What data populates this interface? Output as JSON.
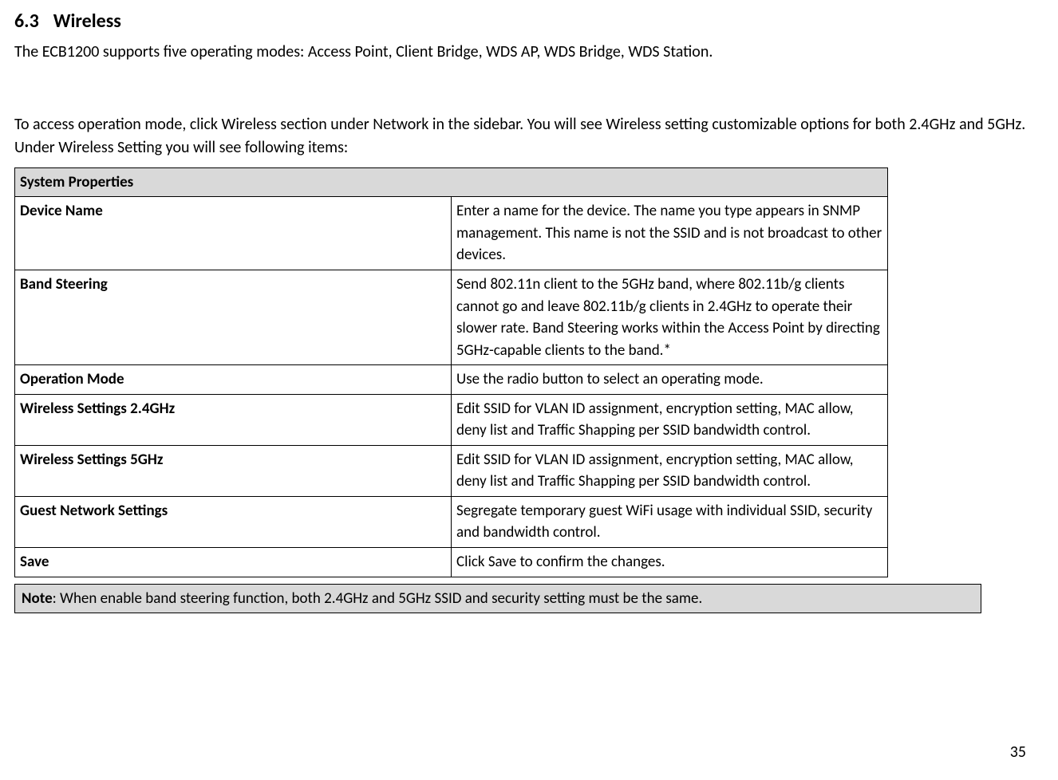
{
  "heading": {
    "number": "6.3",
    "title": "Wireless"
  },
  "intro1": "The ECB1200 supports five operating modes: Access Point, Client Bridge, WDS AP, WDS Bridge, WDS Station.",
  "intro2": "To access operation mode, click Wireless section under Network in the sidebar. You will see Wireless setting customizable options for both 2.4GHz and 5GHz. Under Wireless Setting you will see following items:",
  "table": {
    "header": "System Properties",
    "rows": [
      {
        "label": "Device Name",
        "desc": "Enter a name for the device. The name you type appears in SNMP management. This name is not the SSID and is not broadcast to other devices."
      },
      {
        "label": "Band Steering",
        "desc": "Send 802.11n client to the 5GHz band, where 802.11b/g clients cannot go and leave 802.11b/g clients in 2.4GHz to operate their slower rate. Band Steering works within the Access Point by directing 5GHz-capable clients to the band.*"
      },
      {
        "label": "Operation Mode",
        "desc": "Use the radio button to select an operating mode."
      },
      {
        "label": "Wireless Settings 2.4GHz",
        "desc": "Edit SSID for VLAN ID assignment, encryption setting, MAC allow, deny list and Traffic Shapping per SSID bandwidth control."
      },
      {
        "label": "Wireless Settings 5GHz",
        "desc": "Edit SSID for VLAN ID assignment, encryption setting, MAC allow, deny list and Traffic Shapping per SSID bandwidth control."
      },
      {
        "label": "Guest Network Settings",
        "desc": "Segregate temporary guest WiFi usage with individual SSID, security and bandwidth control."
      },
      {
        "label": "Save",
        "desc": "Click Save to confirm the changes."
      }
    ]
  },
  "note": {
    "label": "Note",
    "text": ": When enable band steering function, both 2.4GHz and 5GHz SSID and security setting must be the same."
  },
  "page_number": "35"
}
